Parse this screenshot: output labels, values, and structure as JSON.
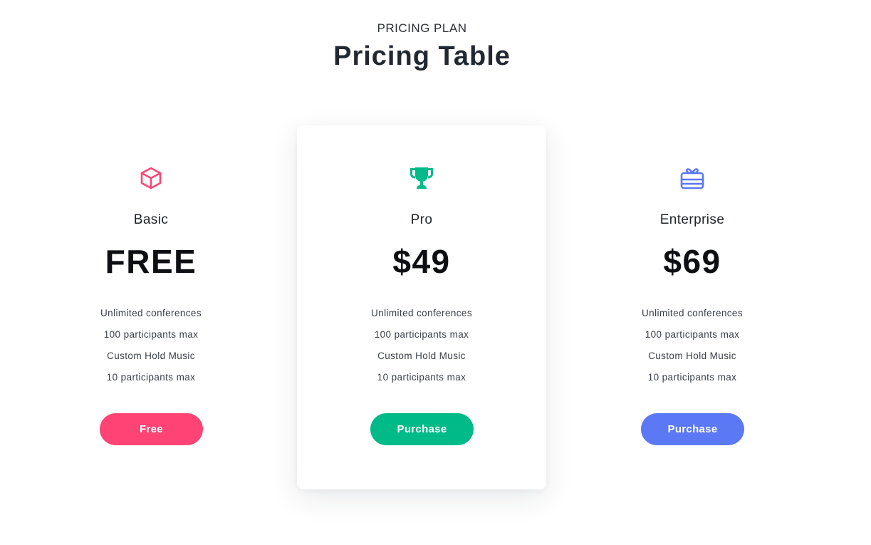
{
  "header": {
    "eyebrow": "PRICING PLAN",
    "title": "Pricing Table"
  },
  "plans": [
    {
      "icon": "cube-icon",
      "name": "Basic",
      "price": "FREE",
      "features": [
        "Unlimited conferences",
        "100 participants max",
        "Custom Hold Music",
        "10 participants max"
      ],
      "button_label": "Free",
      "color": "#ff4475",
      "featured": false
    },
    {
      "icon": "trophy-icon",
      "name": "Pro",
      "price": "$49",
      "features": [
        "Unlimited conferences",
        "100 participants max",
        "Custom Hold Music",
        "10 participants max"
      ],
      "button_label": "Purchase",
      "color": "#00bb87",
      "featured": true
    },
    {
      "icon": "gift-card-icon",
      "name": "Enterprise",
      "price": "$69",
      "features": [
        "Unlimited conferences",
        "100 participants max",
        "Custom Hold Music",
        "10 participants max"
      ],
      "button_label": "Purchase",
      "color": "#5b78f5",
      "featured": false
    }
  ]
}
